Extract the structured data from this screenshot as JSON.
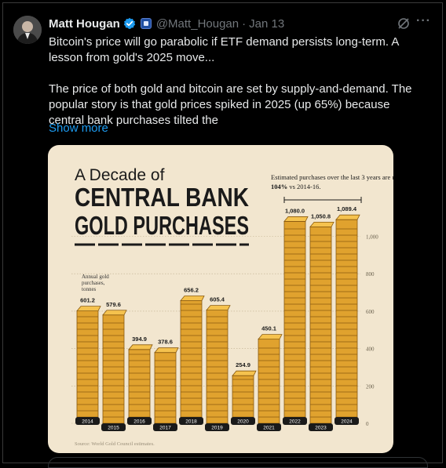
{
  "author": {
    "name": "Matt Hougan",
    "handle": "@Matt_Hougan",
    "separator": "·",
    "date": "Jan 13"
  },
  "tweet": {
    "line1": "Bitcoin's price will go parabolic if ETF demand persists long-term.  A lesson from gold's 2025 move...",
    "line2": "The price of both gold and bitcoin are set by supply-and-demand.  The popular story is that gold prices spiked in 2025 (up 65%) because central bank purchases tilted the",
    "show_more": "Show more"
  },
  "icons": {
    "verified": "verified-badge-icon",
    "affiliate": "affiliate-badge-icon",
    "grok": "grok-icon",
    "more": "more-icon"
  },
  "infographic": {
    "title_small": "A Decade of",
    "title_line1": "CENTRAL BANK",
    "title_line2": "GOLD PURCHASES",
    "note_text": "Estimated purchases over the last 3 years are up",
    "note_highlight": "104%",
    "note_tail": "vs 2014-16.",
    "unit_label": "Annual gold purchases, tonnes",
    "source": "Source: World Gold Council estimates."
  },
  "colors": {
    "background": "#000000",
    "text": "#e7e9ea",
    "muted": "#71767b",
    "link": "#1d9bf0",
    "card": "#f2e6cf",
    "gold": "#e0a22e",
    "gold_dark": "#8a5a0e"
  },
  "chart_data": {
    "type": "bar",
    "categories": [
      "2014",
      "2015",
      "2016",
      "2017",
      "2018",
      "2019",
      "2020",
      "2021",
      "2022",
      "2023",
      "2024"
    ],
    "values": [
      601.2,
      579.6,
      394.9,
      378.6,
      656.2,
      605.4,
      254.9,
      450.1,
      1080.0,
      1050.8,
      1089.4
    ],
    "value_labels": [
      "601.2",
      "579.6",
      "394.9",
      "378.6",
      "656.2",
      "605.4",
      "254.9",
      "450.1",
      "1,080.0",
      "1,050.8",
      "1,089.4"
    ],
    "y_ticks": [
      "0",
      "200",
      "400",
      "600",
      "800",
      "1,000"
    ],
    "y_tick_values": [
      0,
      200,
      400,
      600,
      800,
      1000
    ],
    "ylim": [
      0,
      1100
    ],
    "grid": true,
    "ylabel": "Annual gold purchases, tonnes",
    "title": "A Decade of CENTRAL BANK GOLD PURCHASES"
  }
}
